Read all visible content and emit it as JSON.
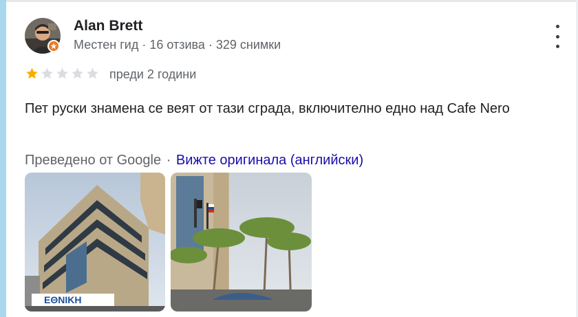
{
  "reviewer": {
    "name": "Alan Brett",
    "meta": "Местен гид · 16 отзива · 329 снимки"
  },
  "rating": {
    "value": 1,
    "max": 5
  },
  "time_ago": "преди 2 години",
  "review_text": "Пет руски знамена се веят от тази сграда, включително едно над Cafe Nero",
  "translation": {
    "prefix": "Преведено от Google",
    "separator": "·",
    "link": "Вижте оригинала (английски)"
  },
  "photo_sign_text": "ΕΘΝΙΚΗ",
  "colors": {
    "star_filled": "#f9ab00",
    "star_empty": "#dadce0",
    "link": "#1a0dab",
    "badge": "#ea7a25"
  }
}
